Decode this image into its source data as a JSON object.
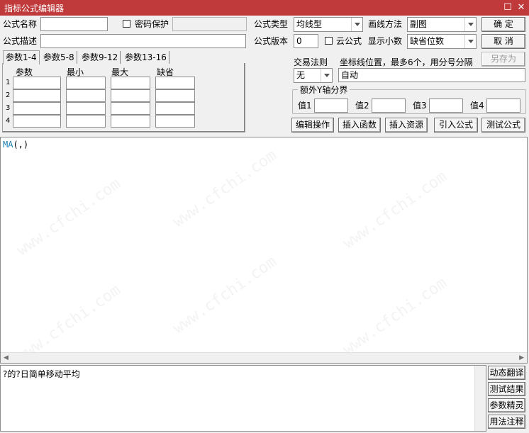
{
  "window": {
    "title": "指标公式编辑器",
    "restore_glyph": "☐",
    "close_glyph": "✕"
  },
  "form": {
    "name_label": "公式名称",
    "name_value": "",
    "password_label": "密码保护",
    "password_value": "",
    "type_label": "公式类型",
    "type_value": "均线型",
    "draw_label": "画线方法",
    "draw_value": "副图",
    "desc_label": "公式描述",
    "desc_value": "",
    "version_label": "公式版本",
    "version_value": "0",
    "cloud_label": "云公式",
    "decimals_label": "显示小数",
    "decimals_value": "缺省位数"
  },
  "buttons": {
    "ok": "确  定",
    "cancel": "取  消",
    "save_as": "另存为",
    "edit_ops": "编辑操作",
    "insert_func": "插入函数",
    "insert_res": "插入资源",
    "import_formula": "引入公式",
    "test_formula": "测试公式"
  },
  "tabs": [
    "参数1-4",
    "参数5-8",
    "参数9-12",
    "参数13-16"
  ],
  "params": {
    "headers": [
      "参数",
      "最小",
      "最大",
      "缺省"
    ],
    "rows": [
      "1",
      "2",
      "3",
      "4"
    ]
  },
  "trade": {
    "label": "交易法则",
    "value": "无"
  },
  "coord": {
    "label": "坐标线位置，最多6个，用分号分隔",
    "value": "自动"
  },
  "yaxis": {
    "title": "额外Y轴分界",
    "labels": [
      "值1",
      "值2",
      "值3",
      "值4"
    ]
  },
  "editor": {
    "keyword": "MA",
    "rest": "(,)"
  },
  "watermark": "www.cfchi.com",
  "description": "?的?日简单移动平均",
  "side_buttons": [
    "动态翻译",
    "测试结果",
    "参数精灵",
    "用法注释"
  ]
}
